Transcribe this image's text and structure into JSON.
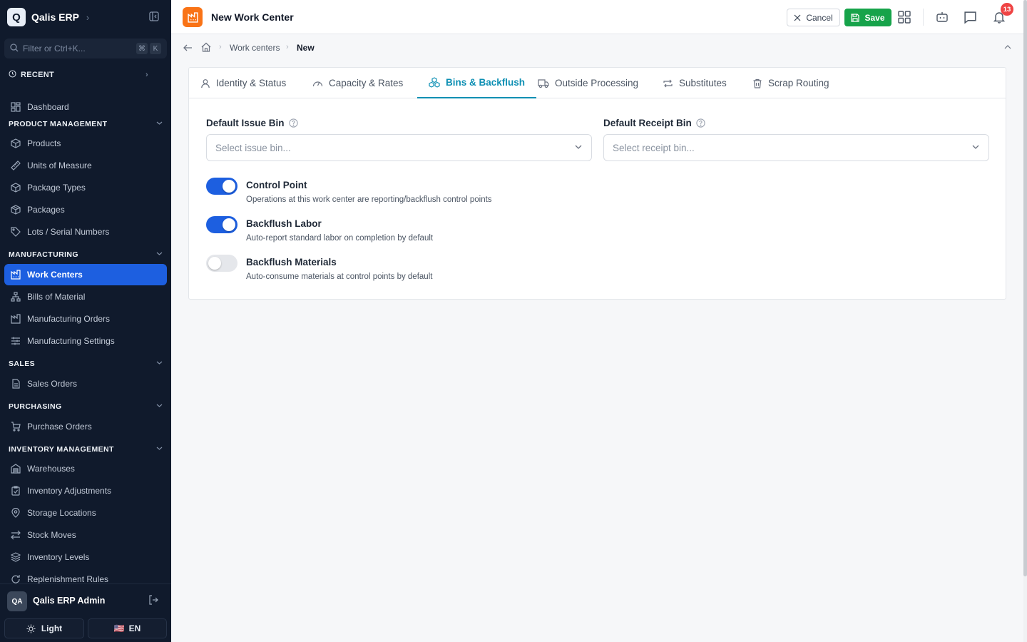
{
  "app": {
    "logo_letter": "Q",
    "name": "Qalis ERP"
  },
  "search": {
    "placeholder": "Filter or Ctrl+K...",
    "kbd1": "⌘",
    "kbd2": "K"
  },
  "recent_label": "RECENT",
  "nav": {
    "dashboard": "Dashboard",
    "sections": {
      "product": "PRODUCT MANAGEMENT",
      "manufacturing": "MANUFACTURING",
      "sales": "SALES",
      "purchasing": "PURCHASING",
      "inventory": "INVENTORY MANAGEMENT"
    },
    "product_items": [
      "Products",
      "Units of Measure",
      "Package Types",
      "Packages",
      "Lots / Serial Numbers"
    ],
    "manufacturing_items": [
      "Work Centers",
      "Bills of Material",
      "Manufacturing Orders",
      "Manufacturing Settings"
    ],
    "sales_items": [
      "Sales Orders"
    ],
    "purchasing_items": [
      "Purchase Orders"
    ],
    "inventory_items": [
      "Warehouses",
      "Inventory Adjustments",
      "Storage Locations",
      "Stock Moves",
      "Inventory Levels",
      "Replenishment Rules"
    ],
    "active_item": "Work Centers"
  },
  "user": {
    "initials": "QA",
    "name": "Qalis ERP Admin"
  },
  "footer": {
    "theme": "Light",
    "flag": "🇺🇸",
    "lang": "EN"
  },
  "topbar": {
    "title": "New Work Center",
    "cancel": "Cancel",
    "save": "Save",
    "notifications": "13"
  },
  "breadcrumb": {
    "parent": "Work centers",
    "current": "New"
  },
  "tabs": [
    "Identity & Status",
    "Capacity & Rates",
    "Bins & Backflush",
    "Outside Processing",
    "Substitutes",
    "Scrap Routing"
  ],
  "active_tab": "Bins & Backflush",
  "form": {
    "issue_bin": {
      "label": "Default Issue Bin",
      "placeholder": "Select issue bin..."
    },
    "receipt_bin": {
      "label": "Default Receipt Bin",
      "placeholder": "Select receipt bin..."
    },
    "toggles": [
      {
        "title": "Control Point",
        "description": "Operations at this work center are reporting/backflush control points",
        "on": true
      },
      {
        "title": "Backflush Labor",
        "description": "Auto-report standard labor on completion by default",
        "on": true
      },
      {
        "title": "Backflush Materials",
        "description": "Auto-consume materials at control points by default",
        "on": false
      }
    ]
  },
  "colors": {
    "sidebar_bg": "#101a2c",
    "accent_blue": "#1d5fe0",
    "tab_accent": "#0d8fb3",
    "save_green": "#16a34a",
    "page_icon_orange": "#f97316",
    "badge_red": "#ef4444"
  }
}
